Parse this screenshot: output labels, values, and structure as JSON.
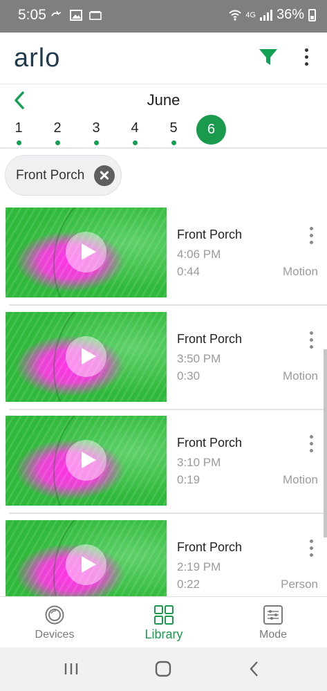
{
  "status_bar": {
    "time": "5:05",
    "network": "4G",
    "battery": "36%"
  },
  "header": {
    "logo": "arlo",
    "filter_icon": "filter-icon",
    "menu_icon": "more-vert-icon"
  },
  "calendar": {
    "month": "June",
    "days": [
      {
        "label": "1",
        "has_recordings": true
      },
      {
        "label": "2",
        "has_recordings": true
      },
      {
        "label": "3",
        "has_recordings": true
      },
      {
        "label": "4",
        "has_recordings": true
      },
      {
        "label": "5",
        "has_recordings": true
      }
    ],
    "selected_day": "6"
  },
  "filter_chip": {
    "label": "Front Porch"
  },
  "recordings": [
    {
      "camera": "Front Porch",
      "time": "4:06 PM",
      "duration": "0:44",
      "type": "Motion"
    },
    {
      "camera": "Front Porch",
      "time": "3:50 PM",
      "duration": "0:30",
      "type": "Motion"
    },
    {
      "camera": "Front Porch",
      "time": "3:10 PM",
      "duration": "0:19",
      "type": "Motion"
    },
    {
      "camera": "Front Porch",
      "time": "2:19 PM",
      "duration": "0:22",
      "type": "Person"
    }
  ],
  "bottom_nav": {
    "items": [
      {
        "label": "Devices",
        "icon": "devices-icon",
        "active": false
      },
      {
        "label": "Library",
        "icon": "library-icon",
        "active": true
      },
      {
        "label": "Mode",
        "icon": "mode-icon",
        "active": false
      }
    ]
  },
  "colors": {
    "accent": "#1a9a4d",
    "logo": "#1f3b4d",
    "status_bar": "#7f7f7f"
  }
}
